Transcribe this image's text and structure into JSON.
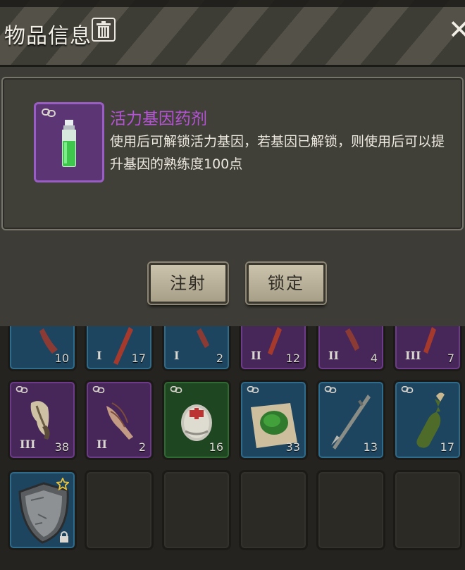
{
  "header": {
    "title": "物品信息"
  },
  "item": {
    "name": "活力基因药剂",
    "description": "使用后可解锁活力基因，若基因已解锁，则使用后可以提升基因的熟练度100点"
  },
  "buttons": {
    "inject": "注射",
    "lock": "锁定"
  },
  "inventory": {
    "row1": [
      {
        "rarity": "blue",
        "tier": "",
        "count": "10"
      },
      {
        "rarity": "blue",
        "tier": "I",
        "count": "17"
      },
      {
        "rarity": "blue",
        "tier": "I",
        "count": "2"
      },
      {
        "rarity": "purple",
        "tier": "II",
        "count": "12"
      },
      {
        "rarity": "purple",
        "tier": "II",
        "count": "4"
      },
      {
        "rarity": "purple",
        "tier": "III",
        "count": "7"
      }
    ],
    "row2": [
      {
        "rarity": "purple",
        "tier": "III",
        "count": "38",
        "icon": "claw-icon"
      },
      {
        "rarity": "purple",
        "tier": "II",
        "count": "2",
        "icon": "feathers-icon"
      },
      {
        "rarity": "green",
        "tier": "",
        "count": "16",
        "icon": "bandage-roll-icon"
      },
      {
        "rarity": "blue",
        "tier": "",
        "count": "33",
        "icon": "herb-cloth-icon"
      },
      {
        "rarity": "blue",
        "tier": "",
        "count": "13",
        "icon": "spear-icon"
      },
      {
        "rarity": "blue",
        "tier": "",
        "count": "17",
        "icon": "bottle-icon"
      }
    ],
    "row3": [
      {
        "rarity": "blue",
        "icon": "shield-icon",
        "badges": [
          "star-icon",
          "padlock-icon"
        ]
      }
    ]
  },
  "colors": {
    "item_name": "#b552d6",
    "rarity_blue": "#2f6b8b",
    "rarity_purple": "#6d3c88",
    "rarity_green": "#2f6a33"
  }
}
